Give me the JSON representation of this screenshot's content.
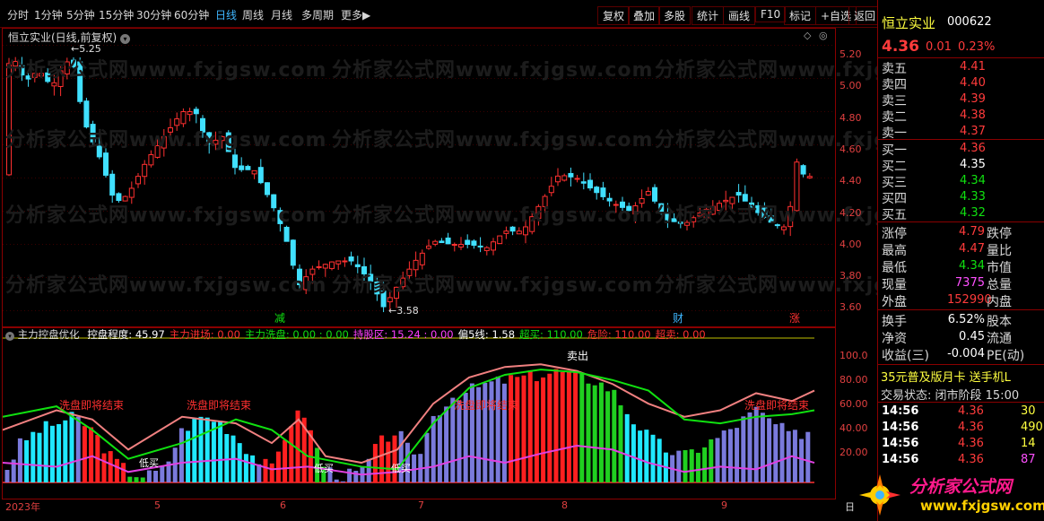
{
  "toolbar": {
    "periods": [
      "分时",
      "1分钟",
      "5分钟",
      "15分钟",
      "30分钟",
      "60分钟",
      "日线",
      "周线",
      "月线",
      "多周期",
      "更多▶"
    ],
    "active_period": "日线",
    "actions": [
      "复权",
      "叠加",
      "多股",
      "统计",
      "画线",
      "F10",
      "标记",
      "+自选",
      "返回"
    ]
  },
  "main_chart": {
    "title": "恒立实业(日线,前复权)",
    "high_label": "5.25",
    "low_label": "3.58",
    "y_ticks": [
      "5.20",
      "5.00",
      "4.80",
      "4.60",
      "4.40",
      "4.20",
      "4.00",
      "3.80",
      "3.60"
    ],
    "markers": [
      "减",
      "财",
      "涨"
    ],
    "watermark": "分析家公式网www.fxjgsw.com"
  },
  "indicator": {
    "name": "主力控盘优化",
    "fields": [
      {
        "label": "控盘程度: 45.97",
        "color": "#ffffff"
      },
      {
        "label": "主力进场: 0.00",
        "color": "#ff3030"
      },
      {
        "label": "主力洗盘: 0.00 : 0.00",
        "color": "#10e010"
      },
      {
        "label": "持股区: 15.24 : 0.00",
        "color": "#ff40ff"
      },
      {
        "label": "偏5线: 1.58",
        "color": "#ffffff"
      },
      {
        "label": "超买: 110.00",
        "color": "#10e010"
      },
      {
        "label": "危险: 110.00",
        "color": "#ff3030"
      },
      {
        "label": "超卖: 0.00",
        "color": "#ff3030"
      }
    ],
    "y_ticks": [
      "100.0",
      "80.00",
      "60.00",
      "40.00",
      "20.00"
    ],
    "texts": [
      "洗盘即将结束",
      "洗盘即将结束",
      "洗盘即将结束",
      "洗盘即将结束",
      "低买",
      "低买",
      "低买",
      "卖出"
    ]
  },
  "time_axis": {
    "labels": [
      "2023年",
      "5",
      "6",
      "7",
      "8",
      "9"
    ],
    "right_label": "日"
  },
  "quote": {
    "name": "恒立实业",
    "code": "000622",
    "price": "4.36",
    "change": "0.01",
    "change_pct": "0.23%",
    "asks": [
      {
        "label": "卖五",
        "price": "4.41"
      },
      {
        "label": "卖四",
        "price": "4.40"
      },
      {
        "label": "卖三",
        "price": "4.39"
      },
      {
        "label": "卖二",
        "price": "4.38"
      },
      {
        "label": "卖一",
        "price": "4.37"
      }
    ],
    "bids": [
      {
        "label": "买一",
        "price": "4.36",
        "color": "#ff3b3b"
      },
      {
        "label": "买二",
        "price": "4.35",
        "color": "#ffffff"
      },
      {
        "label": "买三",
        "price": "4.34",
        "color": "#10e010"
      },
      {
        "label": "买四",
        "price": "4.33",
        "color": "#10e010"
      },
      {
        "label": "买五",
        "price": "4.32",
        "color": "#10e010"
      }
    ],
    "stats": [
      {
        "label": "涨停",
        "value": "4.79",
        "color": "#ff3b3b",
        "label2": "跌停"
      },
      {
        "label": "最高",
        "value": "4.47",
        "color": "#ff3b3b",
        "label2": "量比"
      },
      {
        "label": "最低",
        "value": "4.34",
        "color": "#10e010",
        "label2": "市值"
      },
      {
        "label": "现量",
        "value": "7375",
        "color": "#ff50ff",
        "label2": "总量"
      },
      {
        "label": "外盘",
        "value": "152990",
        "color": "#ff3b3b",
        "label2": "内盘"
      }
    ],
    "stats2": [
      {
        "label": "换手",
        "value": "6.52%",
        "label2": "股本"
      },
      {
        "label": "净资",
        "value": "0.45",
        "label2": "流通"
      },
      {
        "label": "收益(三)",
        "value": "-0.004",
        "label2": "PE(动)"
      }
    ],
    "promo": "35元普及版月卡 送手机L",
    "trade_status": "交易状态: 闭市阶段 15:00",
    "ticks": [
      {
        "time": "14:56",
        "price": "4.36",
        "vol": "30",
        "vcolor": "#ffff40"
      },
      {
        "time": "14:56",
        "price": "4.36",
        "vol": "490",
        "vcolor": "#ffff40"
      },
      {
        "time": "14:56",
        "price": "4.36",
        "vol": "14",
        "vcolor": "#ffff40"
      },
      {
        "time": "14:56",
        "price": "4.36",
        "vol": "87",
        "vcolor": "#ff50ff"
      }
    ],
    "logo_text": "分析家公式网",
    "logo_url": "www.fxjgsw.com"
  }
}
